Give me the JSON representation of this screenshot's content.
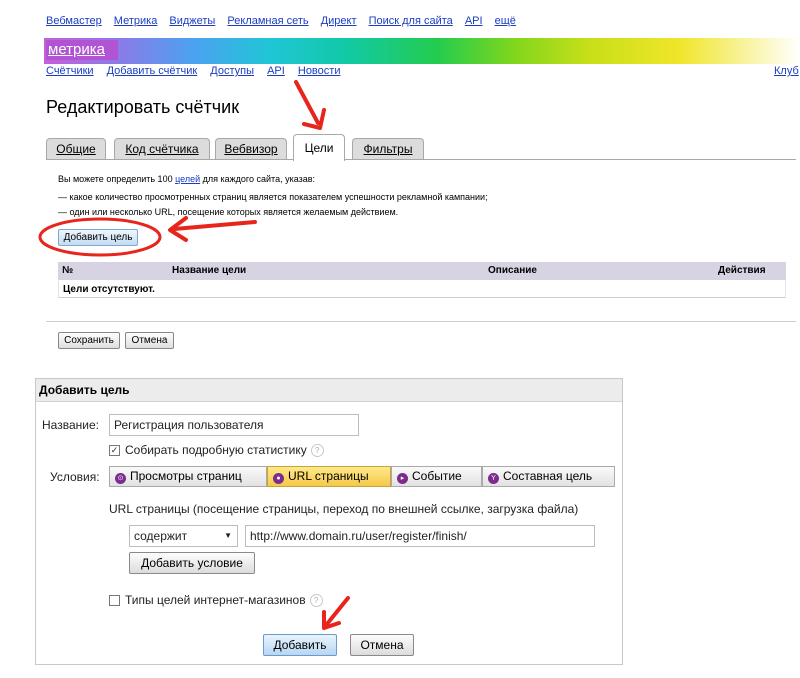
{
  "topnav": [
    "Вебмастер",
    "Метрика",
    "Виджеты",
    "Рекламная сеть",
    "Директ",
    "Поиск для сайта",
    "API",
    "ещё"
  ],
  "brand": "метрика",
  "subnav": [
    "Счётчики",
    "Добавить счётчик",
    "Доступы",
    "API",
    "Новости"
  ],
  "club": "Клуб",
  "page_title": "Редактировать счётчик",
  "tabs": [
    "Общие",
    "Код счётчика",
    "Вебвизор",
    "Цели",
    "Фильтры"
  ],
  "active_tab": "Цели",
  "goals": {
    "intro_prefix": "Вы можете определить 100 ",
    "intro_link": "целей",
    "intro_suffix": " для каждого сайта, указав:",
    "bullet1": "— какое количество просмотренных страниц является показателем успешности рекламной кампании;",
    "bullet2": "— один или несколько URL, посещение которых является желаемым действием.",
    "add_goal_button": "Добавить цель",
    "table_headers": [
      "№",
      "Название цели",
      "Описание",
      "Действия"
    ],
    "empty_text": "Цели отсутствуют.",
    "save_button": "Сохранить",
    "cancel_button": "Отмена"
  },
  "dialog": {
    "title": "Добавить цель",
    "name_label": "Название:",
    "name_value": "Регистрация пользователя",
    "stats_label": "Собирать подробную статистику",
    "stats_checked": true,
    "conditions_label": "Условия:",
    "condition_types": [
      "Просмотры страниц",
      "URL страницы",
      "Событие",
      "Составная цель"
    ],
    "selected_condition": "URL страницы",
    "url_hint": "URL страницы (посещение страницы, переход по внешней ссылке, загрузка файла)",
    "match_select": "содержит",
    "url_value": "http://www.domain.ru/user/register/finish/",
    "add_condition_button": "Добавить условие",
    "shop_label": "Типы целей интернет-магазинов",
    "shop_checked": false,
    "add_button": "Добавить",
    "cancel_button": "Отмена"
  },
  "annotation_color": "#e8251d",
  "brand_color": "#b054d3",
  "link_color": "#1a3dc1"
}
